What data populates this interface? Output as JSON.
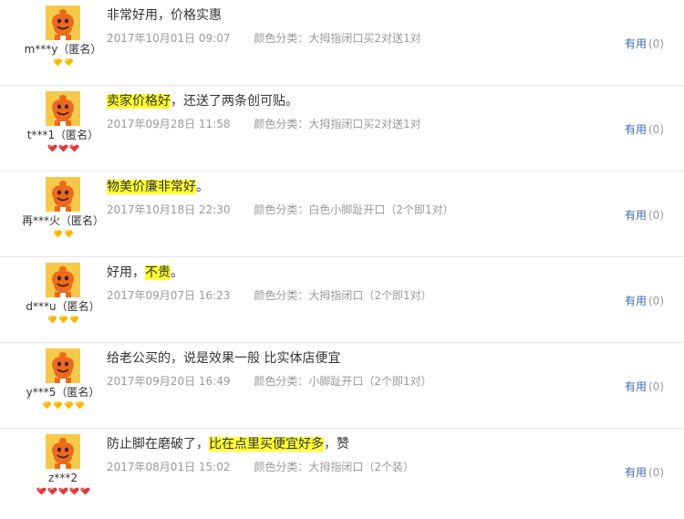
{
  "colors": {
    "avatar_bg": "#f7c94b",
    "mascot": "#ec6a1c",
    "highlight": "#ffff33",
    "link": "#3a6db5",
    "meta": "#999999",
    "gem_gold": "#f5b800",
    "gem_red": "#e4393c"
  },
  "reviews": [
    {
      "username": "m***y（匿名）",
      "comment_segments": [
        {
          "text": "非常好用，价格实惠",
          "highlight": false
        }
      ],
      "date": "2017年10月01日 09:07",
      "color_category": "颜色分类：大拇指闭口买2对送1对",
      "useful_label": "有用",
      "useful_count": "(0)",
      "rank": {
        "count": 2,
        "color": "gold",
        "icon": "diamond-icon"
      }
    },
    {
      "username": "t***1（匿名）",
      "comment_segments": [
        {
          "text": "卖家价格好",
          "highlight": true
        },
        {
          "text": "，还送了两条创可贴。",
          "highlight": false
        }
      ],
      "date": "2017年09月28日 11:58",
      "color_category": "颜色分类：大拇指闭口买2对送1对",
      "useful_label": "有用",
      "useful_count": "(0)",
      "rank": {
        "count": 3,
        "color": "red",
        "icon": "heart-icon"
      }
    },
    {
      "username": "再***火（匿名）",
      "comment_segments": [
        {
          "text": "物美价廉非常好",
          "highlight": true
        },
        {
          "text": "。",
          "highlight": false
        }
      ],
      "date": "2017年10月18日 22:30",
      "color_category": "颜色分类：白色小脚趾开口（2个即1对）",
      "useful_label": "有用",
      "useful_count": "(0)",
      "rank": {
        "count": 2,
        "color": "gold",
        "icon": "diamond-icon"
      }
    },
    {
      "username": "d***u（匿名）",
      "comment_segments": [
        {
          "text": "好用，",
          "highlight": false
        },
        {
          "text": "不贵",
          "highlight": true
        },
        {
          "text": "。",
          "highlight": false
        }
      ],
      "date": "2017年09月07日 16:23",
      "color_category": "颜色分类：大拇指闭口（2个即1对）",
      "useful_label": "有用",
      "useful_count": "(0)",
      "rank": {
        "count": 3,
        "color": "gold",
        "icon": "diamond-icon"
      }
    },
    {
      "username": "y***5（匿名）",
      "comment_segments": [
        {
          "text": "给老公买的，说是效果一般 比实体店便宜",
          "highlight": false
        }
      ],
      "date": "2017年09月20日 16:49",
      "color_category": "颜色分类：小脚趾开口（2个即1对）",
      "useful_label": "有用",
      "useful_count": "(0)",
      "rank": {
        "count": 4,
        "color": "gold",
        "icon": "diamond-icon"
      }
    },
    {
      "username": "z***2",
      "comment_segments": [
        {
          "text": "防止脚在磨破了，",
          "highlight": false
        },
        {
          "text": "比在点里买便宜好多",
          "highlight": true
        },
        {
          "text": "，赞",
          "highlight": false
        }
      ],
      "date": "2017年08月01日 15:02",
      "color_category": "颜色分类：大拇指闭口（2个装）",
      "useful_label": "有用",
      "useful_count": "(0)",
      "rank": {
        "count": 5,
        "color": "red",
        "icon": "heart-icon"
      }
    }
  ]
}
